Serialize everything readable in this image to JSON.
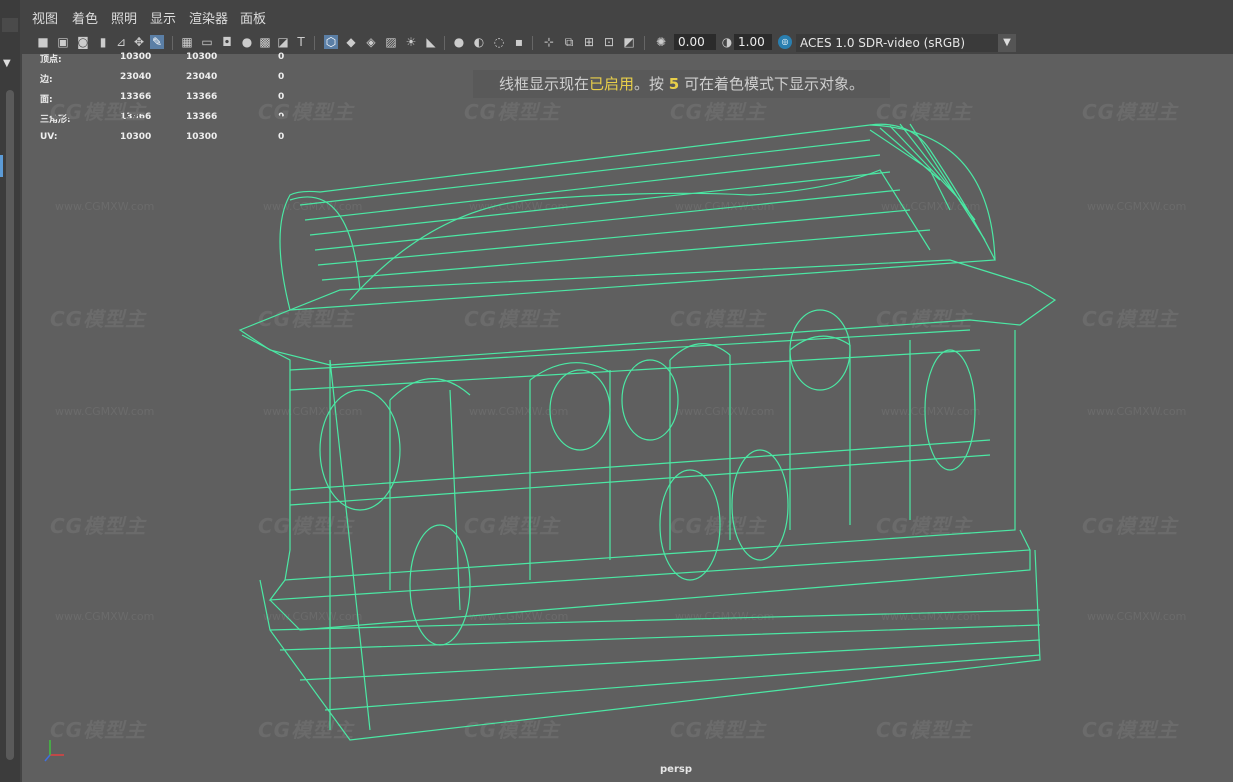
{
  "menu": [
    "视图",
    "着色",
    "照明",
    "显示",
    "渲染器",
    "面板"
  ],
  "toolbar": {
    "exposure_value": "0.00",
    "gamma_value": "1.00",
    "colorspace_label": "ACES 1.0 SDR-video (sRGB)",
    "colorspace_icon": "aces-icon"
  },
  "hud": {
    "rows": [
      {
        "label": "顶点:",
        "a": "10300",
        "b": "10300",
        "c": "0"
      },
      {
        "label": "边:",
        "a": "23040",
        "b": "23040",
        "c": "0"
      },
      {
        "label": "面:",
        "a": "13366",
        "b": "13366",
        "c": "0"
      },
      {
        "label": "三角形:",
        "a": "13366",
        "b": "13366",
        "c": "0"
      },
      {
        "label": "UV:",
        "a": "10300",
        "b": "10300",
        "c": "0"
      }
    ]
  },
  "banner": {
    "pre": "线框显示现在",
    "highlight": "已启用",
    "mid": "。按 ",
    "key": "5",
    "post": " 可在着色模式下显示对象。"
  },
  "watermark": {
    "logo": "CG模型主",
    "url": "www.CGMXW.com"
  },
  "camera_label": "persp",
  "colors": {
    "wireframe": "#4be8a4",
    "viewport_bg": "#5f5f5f",
    "highlight": "#e8cf4a"
  }
}
